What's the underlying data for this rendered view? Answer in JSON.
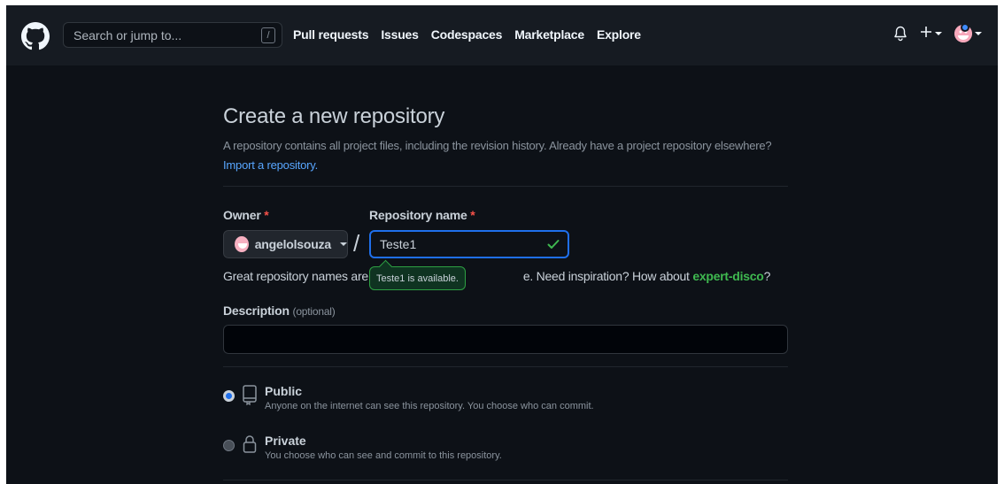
{
  "header": {
    "search_placeholder": "Search or jump to...",
    "search_shortcut": "/",
    "nav": [
      "Pull requests",
      "Issues",
      "Codespaces",
      "Marketplace",
      "Explore"
    ]
  },
  "page": {
    "title": "Create a new repository",
    "subtitle": "A repository contains all project files, including the revision history. Already have a project repository elsewhere?",
    "import_link": "Import a repository."
  },
  "form": {
    "owner_label": "Owner",
    "required_mark": "*",
    "owner_value": "angelolsouza",
    "separator": "/",
    "repo_label": "Repository name",
    "repo_value": "Teste1",
    "hint_prefix": "Great repository names are sh",
    "hint_mid": "e. Need inspiration? How about ",
    "hint_suggestion": "expert-disco",
    "hint_suffix": "?",
    "tooltip": "Teste1 is available.",
    "description_label": "Description",
    "description_optional": "(optional)",
    "description_value": ""
  },
  "visibility": {
    "options": [
      {
        "title": "Public",
        "desc": "Anyone on the internet can see this repository. You choose who can commit.",
        "selected": true
      },
      {
        "title": "Private",
        "desc": "You choose who can see and commit to this repository.",
        "selected": false
      }
    ]
  },
  "colors": {
    "accent": "#1f6feb",
    "link": "#58a6ff",
    "success": "#3fb950",
    "danger": "#f85149"
  },
  "icons": [
    "github-logo-icon",
    "bell-icon",
    "plus-icon",
    "check-icon",
    "repo-icon",
    "lock-icon"
  ]
}
